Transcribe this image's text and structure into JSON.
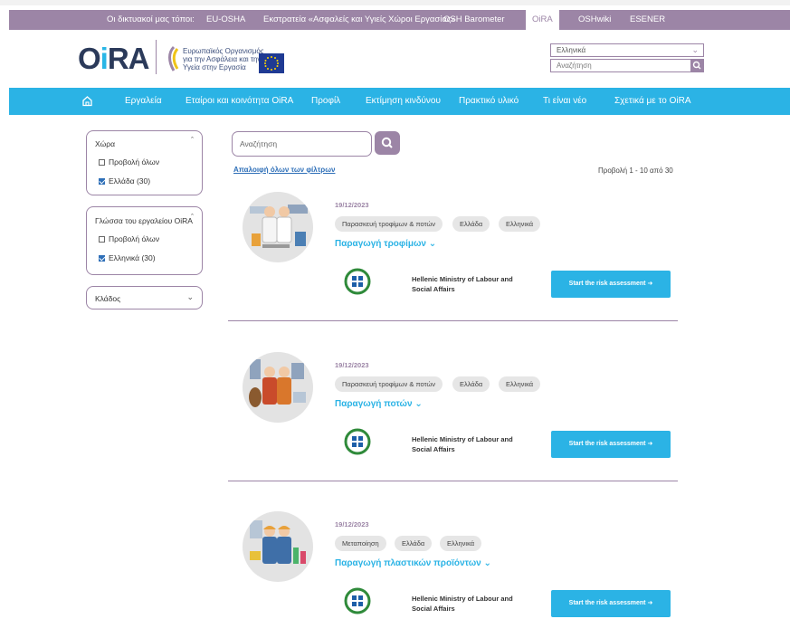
{
  "sites_bar": {
    "items": [
      "Οι δικτυακοί μας τόποι:",
      "EU-OSHA",
      "Εκστρατεία «Ασφαλείς και Υγιείς Χώροι Εργασίας»",
      "OSH Barometer",
      "OiRA",
      "OSHwiki",
      "ESENER"
    ],
    "active": "OiRA"
  },
  "header": {
    "logo": "OiRA",
    "agency_line1": "Ευρωπαϊκός Οργανισμός",
    "agency_line2": "για την Ασφάλεια και την",
    "agency_line3": "Υγεία στην Εργασία",
    "language": "Ελληνικά",
    "search_placeholder": "Αναζήτηση"
  },
  "main_nav": {
    "home_icon": "home-icon",
    "items": [
      "Εργαλεία",
      "Εταίροι και κοινότητα OiRA",
      "Προφίλ",
      "Εκτίμηση κινδύνου",
      "Πρακτικό υλικό",
      "Τι είναι νέο",
      "Σχετικά με το OiRA"
    ]
  },
  "facets": {
    "country": {
      "title": "Χώρα",
      "options": [
        {
          "label": "Προβολή όλων",
          "checked": false
        },
        {
          "label": "Ελλάδα (30)",
          "checked": true
        }
      ]
    },
    "language": {
      "title": "Γλώσσα του εργαλείου OiRA",
      "options": [
        {
          "label": "Προβολή όλων",
          "checked": false
        },
        {
          "label": "Ελληνικά (30)",
          "checked": true
        }
      ]
    },
    "sector": {
      "title": "Κλάδος"
    }
  },
  "results": {
    "search_placeholder": "Αναζήτηση",
    "clear_filters": "Απαλοιφή όλων των φίλτρων",
    "count_text": "Προβολή 1 - 10 από 30",
    "items": [
      {
        "date": "19/12/2023",
        "tags": [
          "Παρασκευή τροφίμων & ποτών",
          "Ελλάδα",
          "Ελληνικά"
        ],
        "title": "Παραγωγή τροφίμων",
        "org_line1": "Hellenic Ministry of Labour and",
        "org_line2": "Social Affairs",
        "button": "Start the risk assessment"
      },
      {
        "date": "19/12/2023",
        "tags": [
          "Παρασκευή τροφίμων & ποτών",
          "Ελλάδα",
          "Ελληνικά"
        ],
        "title": "Παραγωγή ποτών",
        "org_line1": "Hellenic Ministry of Labour and",
        "org_line2": "Social Affairs",
        "button": "Start the risk assessment"
      },
      {
        "date": "19/12/2023",
        "tags": [
          "Μεταποίηση",
          "Ελλάδα",
          "Ελληνικά"
        ],
        "title": "Παραγωγή πλαστικών προϊόντων",
        "org_line1": "Hellenic Ministry of Labour and",
        "org_line2": "Social Affairs",
        "button": "Start the risk assessment"
      }
    ]
  },
  "colors": {
    "purple": "#9c85a6",
    "blue": "#2bb3e5",
    "link": "#2e6fb8",
    "navy": "#2b3a5a"
  }
}
